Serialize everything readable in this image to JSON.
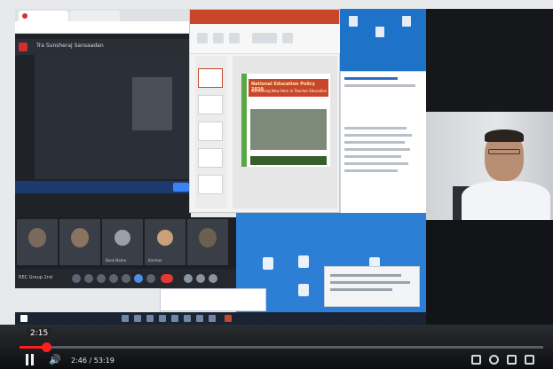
{
  "meeting": {
    "title": "Tra Sunsheraj Sansaadan"
  },
  "ppt_slide": {
    "headline": "National Education Policy 2020",
    "subline": "Something New Here in Teacher Education"
  },
  "participants": [
    {
      "name": ""
    },
    {
      "name": ""
    },
    {
      "name": "Book Name"
    },
    {
      "name": "Karman"
    },
    {
      "name": ""
    }
  ],
  "controls": {
    "label": "REC Group 2nd"
  },
  "player": {
    "current_time_bubble": "2:15",
    "timecode": "2:46 / 53:19",
    "progress_fraction": 0.05,
    "accent": "#ff1f1f"
  },
  "icons": {
    "pause": "pause-icon",
    "volume": "volume-icon",
    "settings": "gear-icon",
    "fullscreen": "fullscreen-icon",
    "theater": "theater-icon",
    "miniplayer": "miniplayer-icon"
  }
}
